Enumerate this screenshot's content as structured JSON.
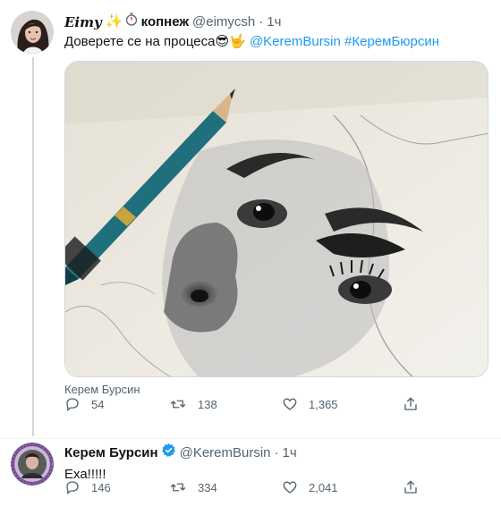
{
  "tweets": [
    {
      "display_name": "Eimy ✨⏱ копнеж",
      "name_main": "Eimy",
      "name_suffix": "копнеж",
      "handle": "@eimycsh",
      "time": "1ч",
      "text_main": "Доверете се на процеса",
      "text_emoji": "😎🤟",
      "mention": "@KeremBursin",
      "hashtag": "#КеремБюрсин",
      "media_caption": "Керем Бурсин",
      "replies": "54",
      "retweets": "138",
      "likes": "1,365"
    },
    {
      "display_name": "Керем Бурсин",
      "handle": "@KeremBursin",
      "time": "1ч",
      "text": "Еха!!!!!",
      "replies": "146",
      "retweets": "334",
      "likes": "2,041"
    }
  ],
  "colors": {
    "link": "#1d9bf0",
    "secondary_text": "#536471",
    "verified": "#1d9bf0",
    "thread_line": "#cfd9de"
  },
  "icons": [
    "reply-icon",
    "retweet-icon",
    "like-icon",
    "share-icon",
    "verified-badge-icon",
    "sparkles-icon",
    "stopwatch-icon"
  ]
}
